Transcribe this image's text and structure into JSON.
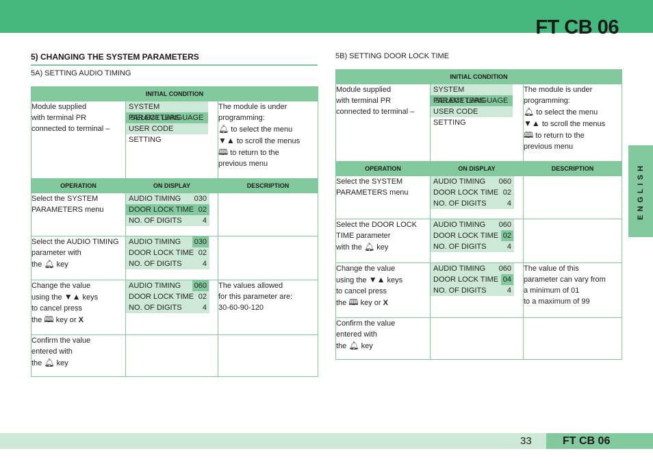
{
  "header": {
    "title": "FT CB 06"
  },
  "section": {
    "title": "5) CHANGING THE SYSTEM PARAMETERS"
  },
  "side_tab": {
    "label": "ENGLISH"
  },
  "footer": {
    "page_number": "33",
    "brand": "FT CB 06"
  },
  "colors": {
    "header_green": "#45b97d",
    "table_green": "#82c99d",
    "lcd_bg": "#cde8d6"
  },
  "icons": {
    "bell": "bell-icon",
    "arrows": "down-up-arrows-icon",
    "book": "book-icon",
    "cancel": "x-key"
  },
  "common": {
    "initial_condition": "INITIAL CONDITION",
    "col_operation": "OPERATION",
    "col_display": "ON DISPLAY",
    "col_description": "DESCRIPTION",
    "init_op": [
      "Module supplied",
      "with terminal PR",
      "connected to terminal –"
    ],
    "init_display": [
      "SYSTEM PARAMETERS",
      "SELECT LANGUAGE",
      "USER CODE SETTING"
    ],
    "init_desc": {
      "l1": "The module is under",
      "l2": "programming:",
      "bell_text": "to select the menu",
      "arrows_text": "to scroll the menus",
      "book_text": "to return to the",
      "l6": "previous menu"
    },
    "lcd_labels": [
      "AUDIO TIMING",
      "DOOR LOCK TIME",
      "NO. OF DIGITS"
    ],
    "confirm": {
      "l1": "Confirm the value",
      "l2": "entered with",
      "l3a": "the",
      "l3b": "key"
    },
    "change": {
      "l1": "Change the value",
      "l2a": "using the",
      "l2b": "keys",
      "l3": "to cancel press",
      "l4a": "the",
      "l4b": "key or",
      "x": "X"
    }
  },
  "audio": {
    "subtitle": "5A) SETTING AUDIO TIMING",
    "rows": [
      {
        "op": [
          "Select the SYSTEM",
          "PARAMETERS menu"
        ],
        "values": [
          "030",
          "02",
          "4"
        ]
      },
      {
        "op": [
          "Select the AUDIO TIMING",
          "parameter with"
        ],
        "op_key_a": "the",
        "op_key_b": "key",
        "values": [
          "030",
          "02",
          "4"
        ]
      },
      {
        "values": [
          "060",
          "02",
          "4"
        ],
        "desc": [
          "The values allowed",
          "for this parameter are:",
          "30-60-90-120"
        ]
      }
    ]
  },
  "door": {
    "subtitle": "5B) SETTING DOOR LOCK TIME",
    "rows": [
      {
        "op": [
          "Select the SYSTEM",
          "PARAMETERS menu"
        ],
        "values": [
          "060",
          "02",
          "4"
        ]
      },
      {
        "op": [
          "Select the DOOR LOCK",
          "TIME parameter"
        ],
        "op_key_a": "with the",
        "op_key_b": "key",
        "values": [
          "060",
          "02",
          "4"
        ]
      },
      {
        "values": [
          "060",
          "04",
          "4"
        ],
        "desc": [
          "The value of this",
          "parameter can vary from",
          "a minimum of 01",
          "to a maximum of 99"
        ]
      }
    ]
  }
}
